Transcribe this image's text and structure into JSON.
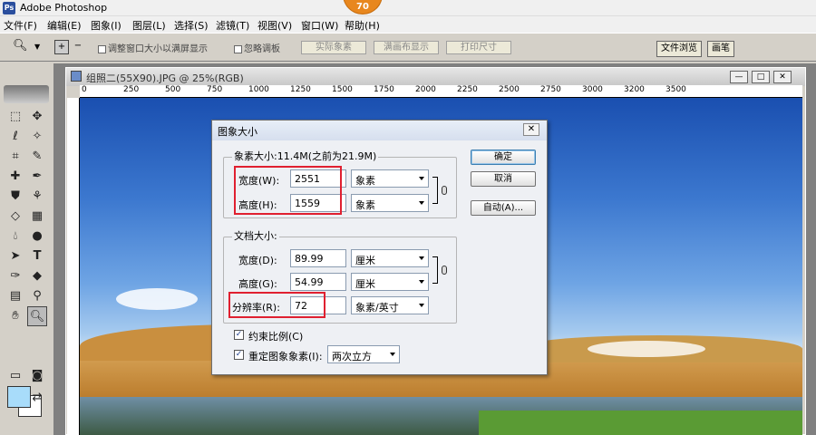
{
  "app": {
    "title": "Adobe Photoshop",
    "badge": "70"
  },
  "menu": [
    "文件(F)",
    "编辑(E)",
    "图象(I)",
    "图层(L)",
    "选择(S)",
    "滤镜(T)",
    "视图(V)",
    "窗口(W)",
    "帮助(H)"
  ],
  "options": {
    "resize_window": "调整窗口大小以满屏显示",
    "ignore_palettes": "忽略调板",
    "actual_pixels": "实际象素",
    "fit_screen": "满画布显示",
    "print_size": "打印尺寸",
    "tabs": [
      "文件浏览",
      "画笔"
    ]
  },
  "document": {
    "title": "组照二(55X90).JPG @ 25%(RGB)",
    "ruler_marks": [
      "0",
      "250",
      "500",
      "750",
      "1000",
      "1250",
      "1500",
      "1750",
      "2000",
      "2250",
      "2500",
      "2750",
      "3000",
      "3200",
      "3500"
    ]
  },
  "dialog": {
    "title": "图象大小",
    "pixel_dims_label": "象素大小:11.4M(之前为21.9M)",
    "width_label": "宽度(W):",
    "width_value": "2551",
    "width_unit": "象素",
    "height_label": "高度(H):",
    "height_value": "1559",
    "height_unit": "象素",
    "doc_size_label": "文档大小:",
    "doc_width_label": "宽度(D):",
    "doc_width_value": "89.99",
    "doc_width_unit": "厘米",
    "doc_height_label": "高度(G):",
    "doc_height_value": "54.99",
    "doc_height_unit": "厘米",
    "resolution_label": "分辨率(R):",
    "resolution_value": "72",
    "resolution_unit": "象素/英寸",
    "constrain_label": "约束比例(C)",
    "resample_label": "重定图象象素(I):",
    "resample_method": "两次立方",
    "ok": "确定",
    "cancel": "取消",
    "auto": "自动(A)..."
  },
  "colors": {
    "foreground": "#a8dcfa",
    "background": "#ffffff",
    "highlight": "#e02030"
  }
}
